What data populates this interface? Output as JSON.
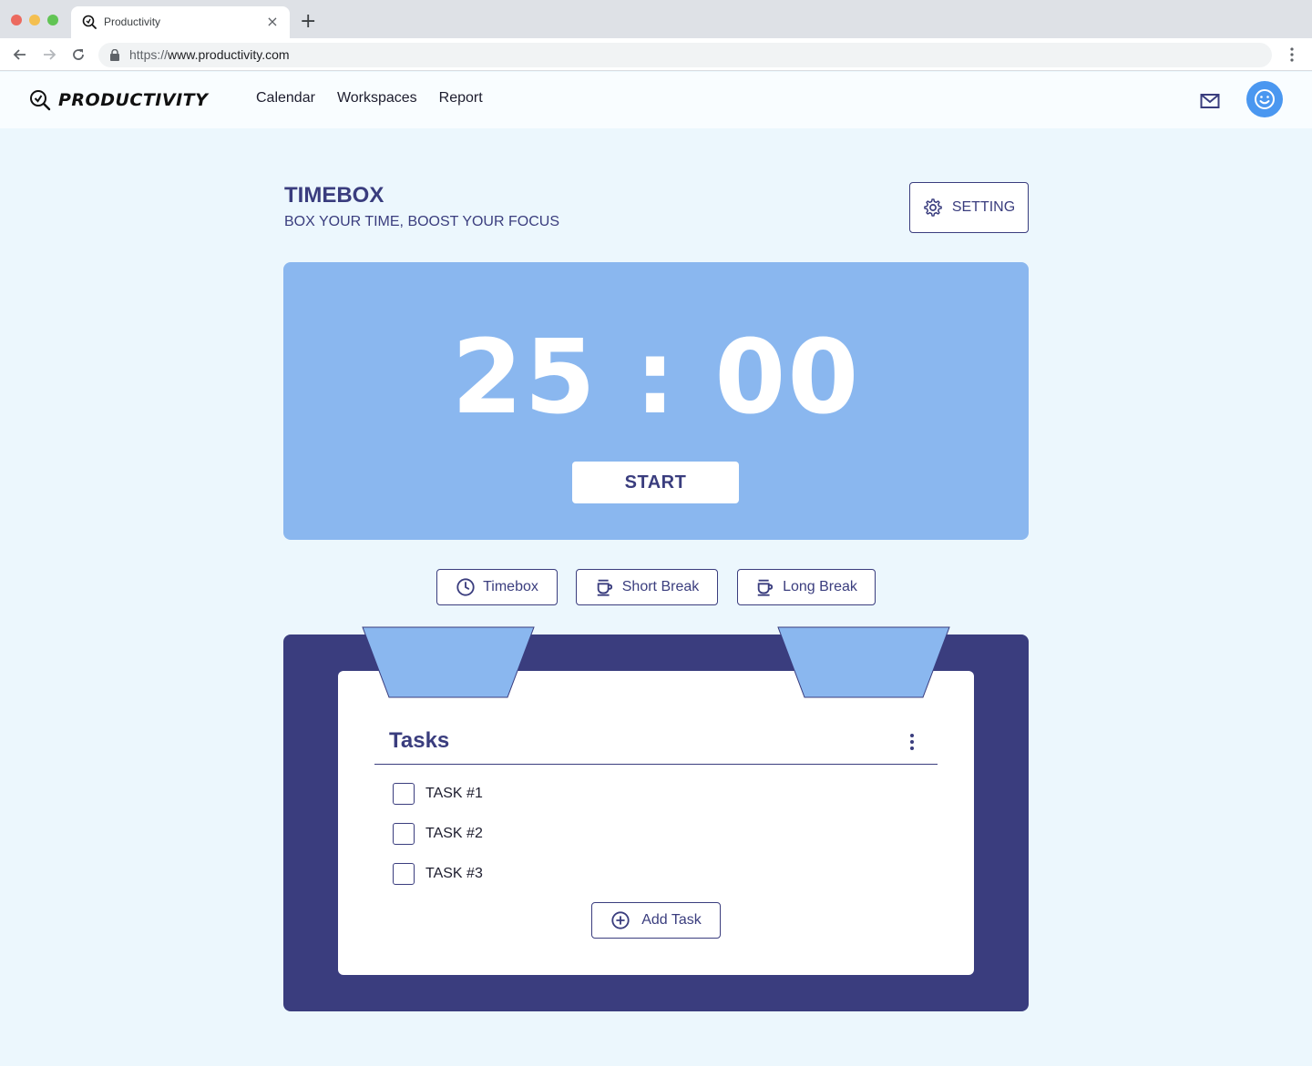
{
  "browser": {
    "tab_title": "Productivity",
    "tab_icon": "logo-icon",
    "new_tab_symbol": "+",
    "close_symbol": "×",
    "url_protocol": "https://",
    "url_host": "www.productivity.com",
    "traffic_colors": [
      "#ec6a5f",
      "#f4bf50",
      "#61c454"
    ]
  },
  "header": {
    "brand_name": "PRODUCTIVITY",
    "nav": [
      "Calendar",
      "Workspaces",
      "Report"
    ],
    "mail_icon": "mail-icon",
    "avatar_icon": "smiley-icon",
    "avatar_color": "#4a97f0"
  },
  "page": {
    "title": "TIMEBOX",
    "subtitle": "BOX YOUR TIME, BOOST YOUR FOCUS",
    "setting_label": "SETTING"
  },
  "timer": {
    "display": "25 : 00",
    "start_label": "START",
    "card_color": "#8ab7ef"
  },
  "modes": [
    {
      "label": "Timebox",
      "icon": "clock-icon"
    },
    {
      "label": "Short Break",
      "icon": "cup-icon"
    },
    {
      "label": "Long Break",
      "icon": "cup-icon"
    }
  ],
  "tasks": {
    "title": "Tasks",
    "items": [
      {
        "label": "TASK #1",
        "checked": false
      },
      {
        "label": "TASK #2",
        "checked": false
      },
      {
        "label": "TASK #3",
        "checked": false
      }
    ],
    "add_label": "Add Task",
    "board_color": "#3a3d7e"
  }
}
